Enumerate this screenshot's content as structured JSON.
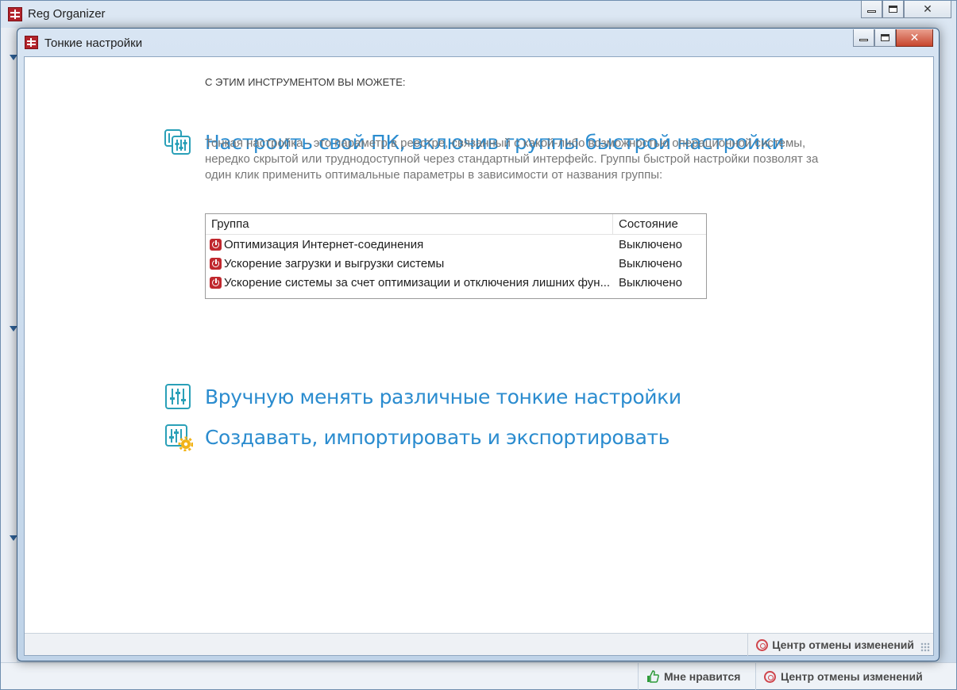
{
  "main_window": {
    "title": "Reg Organizer",
    "status": {
      "like_label": "Мне нравится",
      "undo_center_label": "Центр отмены изменений"
    }
  },
  "dialog": {
    "title": "Тонкие настройки",
    "caption": "С ЭТИМ ИНСТРУМЕНТОМ ВЫ МОЖЕТЕ:",
    "actions": [
      {
        "label": "Настроить свой ПК, включив группы быстрой настройки",
        "icon": "quick-tweaks-icon"
      },
      {
        "label": "Вручную менять различные тонкие настройки",
        "icon": "sliders-icon"
      },
      {
        "label": "Создавать, импортировать и экспортировать",
        "icon": "sliders-gear-icon"
      }
    ],
    "description": "Тонкая настройка - это параметр в реестре, связанный с какой-либо возможностью операционной системы, нередко скрытой или труднодоступной через стандартный интерфейс. Группы быстрой настройки позволят за один клик применить оптимальные параметры в зависимости от названия группы:",
    "table": {
      "columns": [
        "Группа",
        "Состояние"
      ],
      "rows": [
        {
          "group": "Оптимизация Интернет-соединения",
          "state": "Выключено"
        },
        {
          "group": "Ускорение загрузки и выгрузки системы",
          "state": "Выключено"
        },
        {
          "group": "Ускорение системы за счет оптимизации и отключения лишних фун...",
          "state": "Выключено"
        }
      ]
    },
    "status": {
      "undo_center_label": "Центр отмены изменений"
    }
  },
  "colors": {
    "accent": "#2b8ccf",
    "power_off": "#c0282e",
    "undo": "#d0454c",
    "like": "#2e9b3a"
  }
}
